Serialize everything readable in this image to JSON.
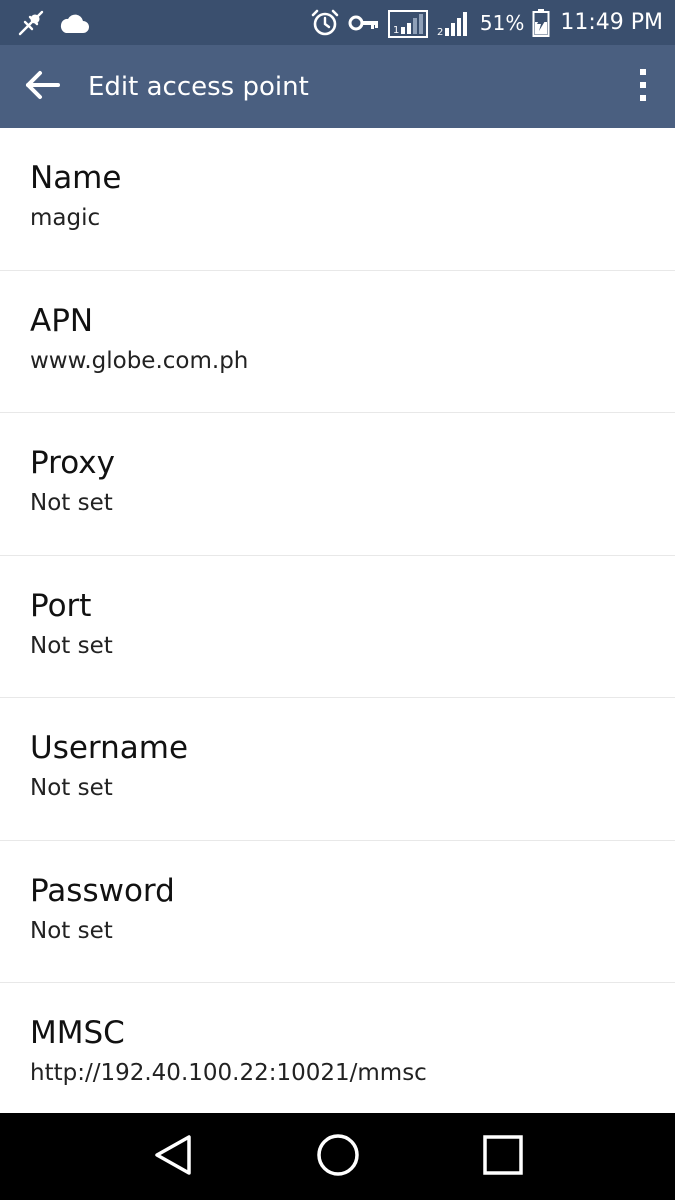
{
  "status_bar": {
    "battery_percent": "51%",
    "time": "11:49 PM",
    "icons": [
      "usb-debug-icon",
      "cloud-icon",
      "alarm-icon",
      "vpn-key-icon",
      "sim1-signal-icon",
      "sim2-signal-icon",
      "battery-charging-icon"
    ]
  },
  "app_bar": {
    "title": "Edit access point",
    "back_icon": "arrow-back-icon",
    "more_icon": "more-vert-icon"
  },
  "preferences": [
    {
      "title": "Name",
      "summary": "magic"
    },
    {
      "title": "APN",
      "summary": "www.globe.com.ph"
    },
    {
      "title": "Proxy",
      "summary": "Not set"
    },
    {
      "title": "Port",
      "summary": "Not set"
    },
    {
      "title": "Username",
      "summary": "Not set"
    },
    {
      "title": "Password",
      "summary": "Not set"
    },
    {
      "title": "MMSC",
      "summary": "http://192.40.100.22:10021/mmsc"
    }
  ],
  "nav_bar": {
    "icons": [
      "back-triangle-icon",
      "home-circle-icon",
      "recents-square-icon"
    ]
  },
  "colors": {
    "status_bar": "#3a4f6e",
    "app_bar": "#4a5f80",
    "background": "#ffffff",
    "nav_bar": "#000000"
  }
}
